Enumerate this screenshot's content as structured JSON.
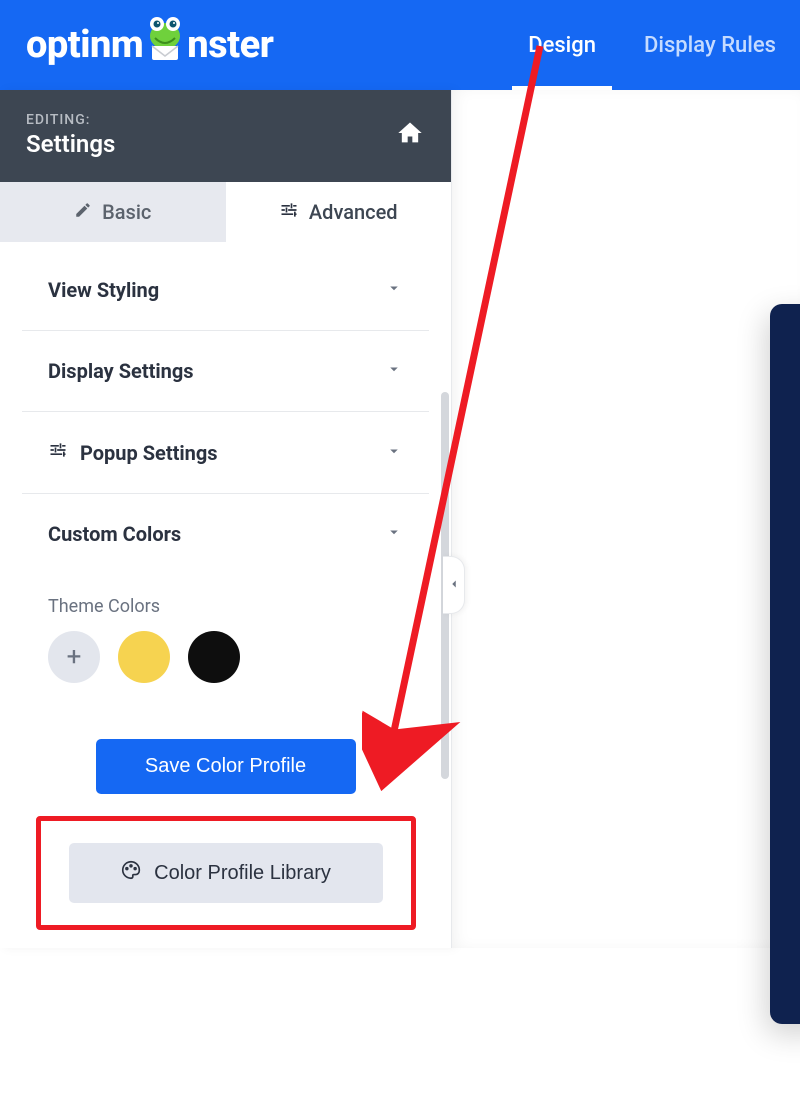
{
  "brand": {
    "name_left": "optinm",
    "name_right": "nster"
  },
  "topnav": {
    "tabs": [
      {
        "label": "Design",
        "active": true
      },
      {
        "label": "Display Rules",
        "active": false
      }
    ]
  },
  "sidebar": {
    "editing_label": "EDITING:",
    "editing_title": "Settings",
    "mode_tabs": {
      "basic": "Basic",
      "advanced": "Advanced"
    },
    "panels": {
      "view_styling": "View Styling",
      "display_settings": "Display Settings",
      "popup_settings": "Popup Settings",
      "custom_colors": "Custom Colors"
    },
    "theme_colors_label": "Theme Colors",
    "theme_colors": {
      "add": "+",
      "c1": "#f6d350",
      "c2": "#0e0e0e"
    },
    "save_profile_label": "Save Color Profile",
    "library_label": "Color Profile Library"
  }
}
